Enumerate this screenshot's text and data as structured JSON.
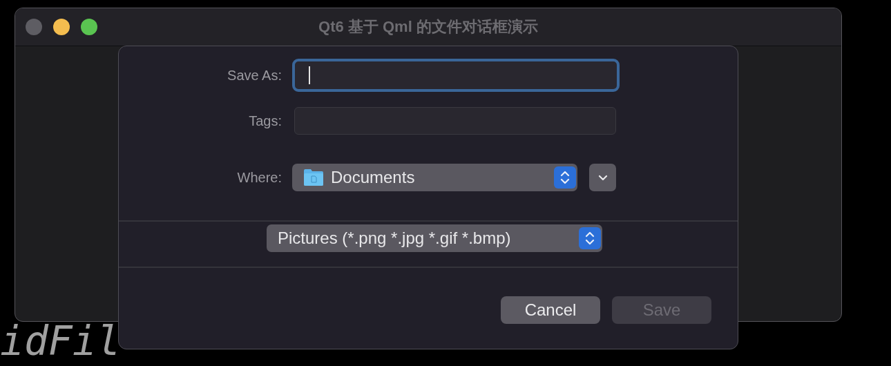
{
  "background_code": {
    "lines": [
      {
        "text": "idFil",
        "color": "#a0a0a0"
      }
    ]
  },
  "window": {
    "title": "Qt6 基于 Qml 的文件对话框演示"
  },
  "dialog": {
    "save_as": {
      "label": "Save As:",
      "focused": true
    },
    "tags": {
      "label": "Tags:"
    },
    "where": {
      "label": "Where:",
      "value": "Documents"
    },
    "file_type": {
      "value": "Pictures (*.png *.jpg *.gif *.bmp)"
    },
    "buttons": [
      {
        "label": "Cancel",
        "disabled": false
      },
      {
        "label": "Save",
        "disabled": true
      }
    ]
  }
}
